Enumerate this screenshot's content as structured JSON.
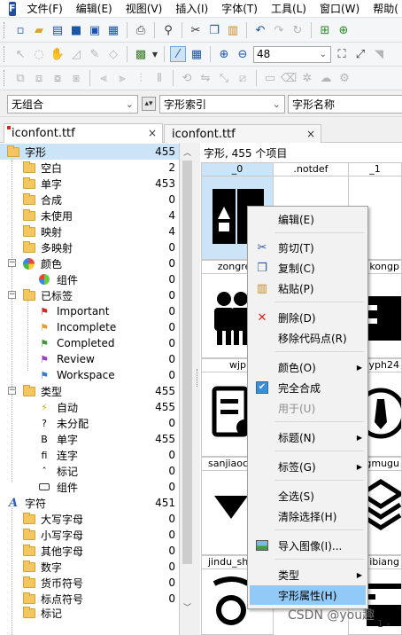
{
  "menubar": {
    "app_icon_letter": "F",
    "items": [
      "文件(F)",
      "编辑(E)",
      "视图(V)",
      "插入(I)",
      "字体(T)",
      "工具(L)",
      "窗口(W)",
      "帮助("
    ]
  },
  "combos": {
    "combine": "无组合",
    "glyph_index": "字形索引",
    "glyph_name": "字形名称",
    "size": "48"
  },
  "tabs": {
    "left": "iconfont.ttf",
    "right": "iconfont.ttf",
    "close_glyph": "×"
  },
  "tree": [
    {
      "label": "字形",
      "count": "455"
    },
    {
      "label": "空白",
      "count": "2"
    },
    {
      "label": "单字",
      "count": "453"
    },
    {
      "label": "合成",
      "count": "0"
    },
    {
      "label": "未使用",
      "count": "4"
    },
    {
      "label": "映射",
      "count": "4"
    },
    {
      "label": "多映射",
      "count": "0"
    },
    {
      "label": "颜色",
      "count": "0"
    },
    {
      "label": "组件",
      "count": "0"
    },
    {
      "label": "已标签",
      "count": "0"
    },
    {
      "label": "Important",
      "count": "0"
    },
    {
      "label": "Incomplete",
      "count": "0"
    },
    {
      "label": "Completed",
      "count": "0"
    },
    {
      "label": "Review",
      "count": "0"
    },
    {
      "label": "Workspace",
      "count": "0"
    },
    {
      "label": "类型",
      "count": "455"
    },
    {
      "label": "自动",
      "count": "455"
    },
    {
      "label": "未分配",
      "count": "0"
    },
    {
      "label": "单字",
      "count": "455"
    },
    {
      "label": "连字",
      "count": "0"
    },
    {
      "label": "标记",
      "count": "0"
    },
    {
      "label": "组件",
      "count": "0"
    },
    {
      "label": "字符",
      "count": "451"
    },
    {
      "label": "大写字母",
      "count": "0"
    },
    {
      "label": "小写字母",
      "count": "0"
    },
    {
      "label": "其他字母",
      "count": "0"
    },
    {
      "label": "数字",
      "count": "0"
    },
    {
      "label": "货币符号",
      "count": "0"
    },
    {
      "label": "标点符号",
      "count": "0"
    },
    {
      "label": "标记",
      "count": ""
    }
  ],
  "tree_glyphs": {
    "auto": "⚡",
    "unassigned": "?",
    "single": "B",
    "ligature": "ﬁ",
    "mark": "ˆ",
    "character": "A"
  },
  "glyph_panel": {
    "header": "字形, 455 个项目",
    "row1": [
      "_0",
      ".notdef",
      "_1"
    ],
    "row2": [
      "zongren",
      "kongp"
    ],
    "row3": [
      "wjp",
      "lyph24"
    ],
    "row4": [
      "sanjiaoc",
      "gmugu"
    ],
    "row5": [
      "jindu_sh",
      "ibiang"
    ]
  },
  "context_menu": {
    "items": [
      {
        "label": "编辑(E)",
        "icon": "",
        "state": "normal"
      },
      {
        "label": "剪切(T)",
        "icon": "scissors-icon",
        "state": "normal"
      },
      {
        "label": "复制(C)",
        "icon": "copy-icon",
        "state": "normal"
      },
      {
        "label": "粘贴(P)",
        "icon": "paste-icon",
        "state": "normal"
      },
      {
        "label": "删除(D)",
        "icon": "delete-x-icon",
        "state": "normal"
      },
      {
        "label": "移除代码点(R)",
        "icon": "",
        "state": "normal"
      },
      {
        "label": "颜色(O)",
        "icon": "",
        "state": "submenu"
      },
      {
        "label": "完全合成",
        "icon": "checkbox-icon",
        "state": "normal"
      },
      {
        "label": "用于(U)",
        "icon": "",
        "state": "disabled"
      },
      {
        "label": "标题(N)",
        "icon": "",
        "state": "submenu"
      },
      {
        "label": "标签(G)",
        "icon": "",
        "state": "submenu"
      },
      {
        "label": "全选(S)",
        "icon": "",
        "state": "normal"
      },
      {
        "label": "清除选择(H)",
        "icon": "",
        "state": "normal"
      },
      {
        "label": "导入图像(I)...",
        "icon": "image-icon",
        "state": "normal"
      },
      {
        "label": "类型",
        "icon": "",
        "state": "submenu"
      },
      {
        "label": "字形属性(H)",
        "icon": "",
        "state": "highlighted"
      }
    ],
    "submenu_glyph": "▶",
    "delete_glyph": "✕",
    "check_glyph": "✔"
  },
  "watermark": "CSDN @you趣",
  "status": "1 ‹",
  "colors": {
    "selection": "#cce4f7",
    "highlight": "#91c9f7",
    "folder": "#f2c660",
    "delete_red": "#d9251d"
  }
}
